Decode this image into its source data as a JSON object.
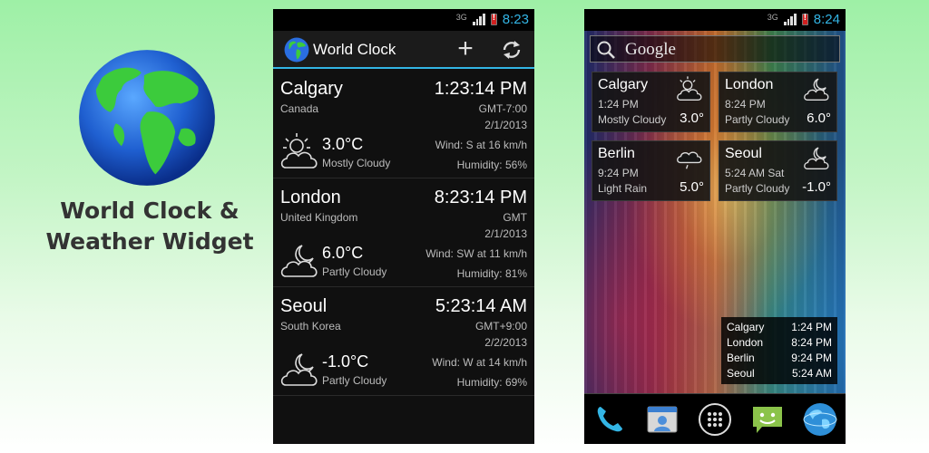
{
  "promo": {
    "title_line1": "World Clock &",
    "title_line2": "Weather Widget"
  },
  "colors": {
    "accent": "#33b5e5",
    "background_top": "#9ef0a6",
    "background_bottom": "#ffffff"
  },
  "status_bar": {
    "network": "3G",
    "time": "8:23"
  },
  "app": {
    "title": "World Clock",
    "actions": {
      "add_icon": "plus-icon",
      "refresh_icon": "refresh-icon"
    },
    "cities": [
      {
        "name": "Calgary",
        "country": "Canada",
        "time": "1:23:14 PM",
        "gmt": "GMT-7:00",
        "date": "2/1/2013",
        "temp": "3.0°C",
        "condition": "Mostly Cloudy",
        "wind": "Wind: S at 16 km/h",
        "humidity": "Humidity: 56%",
        "icon": "mostly-cloudy-icon"
      },
      {
        "name": "London",
        "country": "United Kingdom",
        "time": "8:23:14 PM",
        "gmt": "GMT",
        "date": "2/1/2013",
        "temp": "6.0°C",
        "condition": "Partly Cloudy",
        "wind": "Wind: SW at 11 km/h",
        "humidity": "Humidity: 81%",
        "icon": "partly-cloudy-night-icon"
      },
      {
        "name": "Seoul",
        "country": "South Korea",
        "time": "5:23:14 AM",
        "gmt": "GMT+9:00",
        "date": "2/2/2013",
        "temp": "-1.0°C",
        "condition": "Partly Cloudy",
        "wind": "Wind: W at 14 km/h",
        "humidity": "Humidity: 69%",
        "icon": "partly-cloudy-night-icon"
      }
    ]
  },
  "home": {
    "status_time": "8:24",
    "search_label": "Google",
    "widgets": [
      {
        "city": "Calgary",
        "time": "1:24 PM",
        "condition": "Mostly Cloudy",
        "temp": "3.0°",
        "icon": "mostly-cloudy-icon"
      },
      {
        "city": "London",
        "time": "8:24 PM",
        "condition": "Partly Cloudy",
        "temp": "6.0°",
        "icon": "partly-cloudy-night-icon"
      },
      {
        "city": "Berlin",
        "time": "9:24 PM",
        "condition": "Light Rain",
        "temp": "5.0°",
        "icon": "light-rain-icon"
      },
      {
        "city": "Seoul",
        "time": "5:24 AM Sat",
        "condition": "Partly Cloudy",
        "temp": "-1.0°",
        "icon": "partly-cloudy-night-icon"
      }
    ],
    "clock_list": [
      {
        "city": "Calgary",
        "time": "1:24 PM"
      },
      {
        "city": "London",
        "time": "8:24 PM"
      },
      {
        "city": "Berlin",
        "time": "9:24 PM"
      },
      {
        "city": "Seoul",
        "time": "5:24 AM"
      }
    ],
    "dock": [
      "phone-icon",
      "contacts-icon",
      "app-drawer-icon",
      "messaging-icon",
      "world-clock-icon"
    ]
  }
}
